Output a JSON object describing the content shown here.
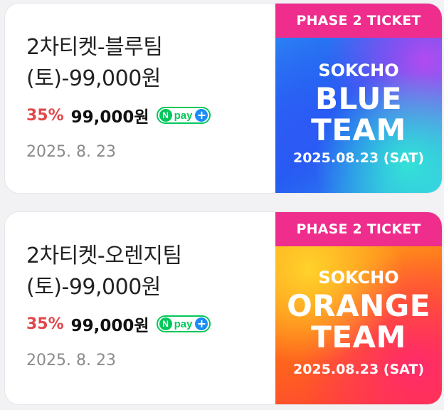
{
  "products": [
    {
      "title_line1": "2차티켓-블루팀",
      "title_line2": "(토)-99,000원",
      "discount": "35%",
      "price": "99,000원",
      "npay_label": "pay",
      "date": "2025. 8. 23",
      "poster": {
        "band": "PHASE 2 TICKET",
        "city": "SOKCHO",
        "team_line1": "BLUE",
        "team_line2": "TEAM",
        "date": "2025.08.23 (SAT)"
      }
    },
    {
      "title_line1": "2차티켓-오렌지팀",
      "title_line2": "(토)-99,000원",
      "discount": "35%",
      "price": "99,000원",
      "npay_label": "pay",
      "date": "2025. 8. 23",
      "poster": {
        "band": "PHASE 2 TICKET",
        "city": "SOKCHO",
        "team_line1": "ORANGE",
        "team_line2": "TEAM",
        "date": "2025.08.23 (SAT)"
      }
    }
  ],
  "colors": {
    "discount": "#e0484b",
    "npay_green": "#03c75a",
    "band_pink": "#ee2d8c"
  }
}
